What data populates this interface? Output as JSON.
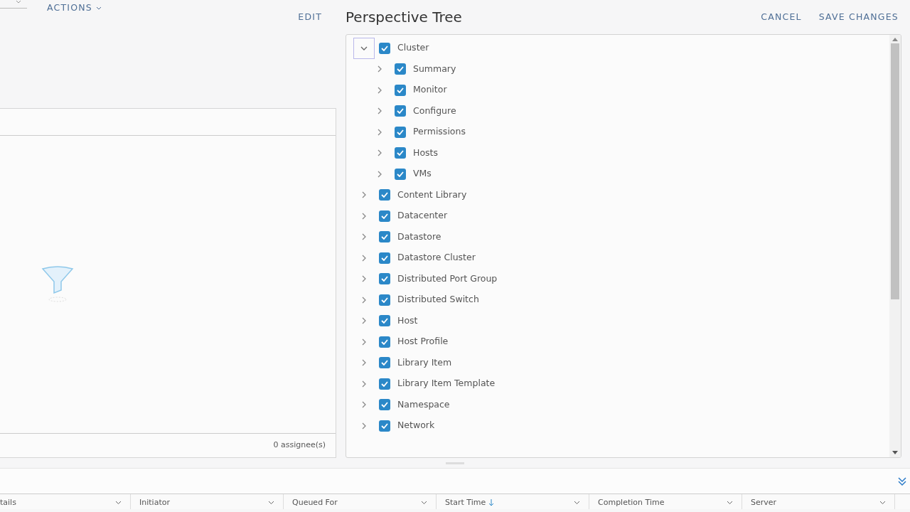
{
  "toolbar": {
    "actions": "ACTIONS"
  },
  "left_panel": {
    "edit": "EDIT",
    "footer": "0 assignee(s)"
  },
  "perspective": {
    "title": "Perspective Tree",
    "buttons": [
      {
        "label": "CANCEL"
      },
      {
        "label": "SAVE CHANGES"
      }
    ]
  },
  "tree": [
    {
      "label": "Cluster",
      "checked": true,
      "expanded": true,
      "focused": true,
      "children": [
        {
          "label": "Summary",
          "checked": true,
          "expanded": false
        },
        {
          "label": "Monitor",
          "checked": true,
          "expanded": false
        },
        {
          "label": "Configure",
          "checked": true,
          "expanded": false
        },
        {
          "label": "Permissions",
          "checked": true,
          "expanded": false
        },
        {
          "label": "Hosts",
          "checked": true,
          "expanded": false
        },
        {
          "label": "VMs",
          "checked": true,
          "expanded": false
        }
      ]
    },
    {
      "label": "Content Library",
      "checked": true,
      "expanded": false
    },
    {
      "label": "Datacenter",
      "checked": true,
      "expanded": false
    },
    {
      "label": "Datastore",
      "checked": true,
      "expanded": false
    },
    {
      "label": "Datastore Cluster",
      "checked": true,
      "expanded": false
    },
    {
      "label": "Distributed Port Group",
      "checked": true,
      "expanded": false
    },
    {
      "label": "Distributed Switch",
      "checked": true,
      "expanded": false
    },
    {
      "label": "Host",
      "checked": true,
      "expanded": false
    },
    {
      "label": "Host Profile",
      "checked": true,
      "expanded": false
    },
    {
      "label": "Library Item",
      "checked": true,
      "expanded": false
    },
    {
      "label": "Library Item Template",
      "checked": true,
      "expanded": false
    },
    {
      "label": "Namespace",
      "checked": true,
      "expanded": false
    },
    {
      "label": "Network",
      "checked": true,
      "expanded": false
    }
  ],
  "tasks_table": {
    "columns": [
      {
        "label": "tails",
        "sorted": false
      },
      {
        "label": "Initiator",
        "sorted": false
      },
      {
        "label": "Queued For",
        "sorted": false
      },
      {
        "label": "Start Time",
        "sorted": true
      },
      {
        "label": "Completion Time",
        "sorted": false
      },
      {
        "label": "Server",
        "sorted": false
      }
    ]
  }
}
